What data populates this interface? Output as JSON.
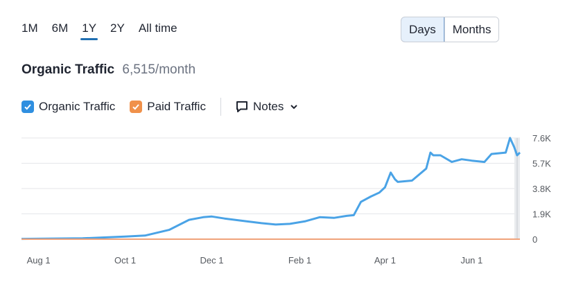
{
  "ranges": [
    "1M",
    "6M",
    "1Y",
    "2Y",
    "All time"
  ],
  "active_range": "1Y",
  "granularity": {
    "days": "Days",
    "months": "Months",
    "selected": "Days"
  },
  "header": {
    "title": "Organic Traffic",
    "value": "6,515/month"
  },
  "legend": {
    "organic": {
      "label": "Organic Traffic",
      "color": "#2f8fe0"
    },
    "paid": {
      "label": "Paid Traffic",
      "color": "#f0914a"
    },
    "notes": "Notes"
  },
  "chart_data": {
    "type": "line",
    "yticks": [
      "7.6K",
      "5.7K",
      "3.8K",
      "1.9K",
      "0"
    ],
    "ylim": [
      0,
      7600
    ],
    "xticks": [
      "Aug 1",
      "Oct 1",
      "Dec 1",
      "Feb 1",
      "Apr 1",
      "Jun 1"
    ],
    "series": [
      {
        "name": "Organic Traffic",
        "color": "#4aa3e6",
        "x": [
          "2023-07-20",
          "2023-09-01",
          "2023-10-01",
          "2023-10-15",
          "2023-11-01",
          "2023-11-15",
          "2023-11-25",
          "2023-12-01",
          "2023-12-10",
          "2023-12-25",
          "2024-01-05",
          "2024-01-15",
          "2024-01-25",
          "2024-02-05",
          "2024-02-15",
          "2024-02-25",
          "2024-03-05",
          "2024-03-10",
          "2024-03-15",
          "2024-03-22",
          "2024-03-28",
          "2024-04-01",
          "2024-04-05",
          "2024-04-08",
          "2024-04-10",
          "2024-04-20",
          "2024-04-30",
          "2024-05-03",
          "2024-05-05",
          "2024-05-10",
          "2024-05-18",
          "2024-05-25",
          "2024-06-01",
          "2024-06-10",
          "2024-06-15",
          "2024-06-25",
          "2024-06-28",
          "2024-07-01",
          "2024-07-03",
          "2024-07-05"
        ],
        "y": [
          20,
          60,
          200,
          270,
          700,
          1450,
          1650,
          1700,
          1550,
          1350,
          1200,
          1100,
          1150,
          1350,
          1650,
          1600,
          1750,
          1800,
          2800,
          3200,
          3500,
          3900,
          5000,
          4500,
          4300,
          4400,
          5300,
          6500,
          6300,
          6300,
          5800,
          6000,
          5900,
          5800,
          6400,
          6500,
          7600,
          6900,
          6300,
          6500
        ]
      },
      {
        "name": "Paid Traffic",
        "color": "#f0a27a",
        "x": [
          "2023-07-20",
          "2024-07-05"
        ],
        "y": [
          0,
          0
        ]
      }
    ]
  }
}
